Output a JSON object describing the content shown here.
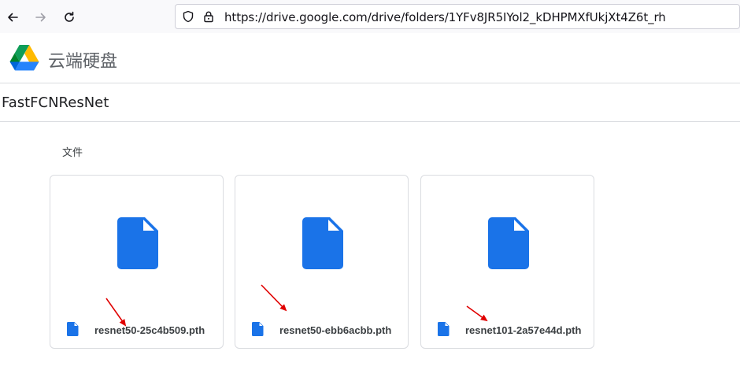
{
  "browser": {
    "url": "https://drive.google.com/drive/folders/1YFv8JR5IYol2_kDHPMXfUkjXt4Z6t_rh"
  },
  "app": {
    "title": "云端硬盘"
  },
  "folder": {
    "name": "FastFCNResNet"
  },
  "section": {
    "label": "文件"
  },
  "files": [
    {
      "name": "resnet50-25c4b509.pth"
    },
    {
      "name": "resnet50-ebb6acbb.pth"
    },
    {
      "name": "resnet101-2a57e44d.pth"
    }
  ],
  "colors": {
    "file_icon": "#1a73e8",
    "annotation_arrow": "#e00000"
  },
  "icons": [
    "back-arrow-icon",
    "forward-arrow-icon",
    "reload-icon",
    "shield-icon",
    "lock-icon",
    "google-drive-logo",
    "document-icon"
  ]
}
